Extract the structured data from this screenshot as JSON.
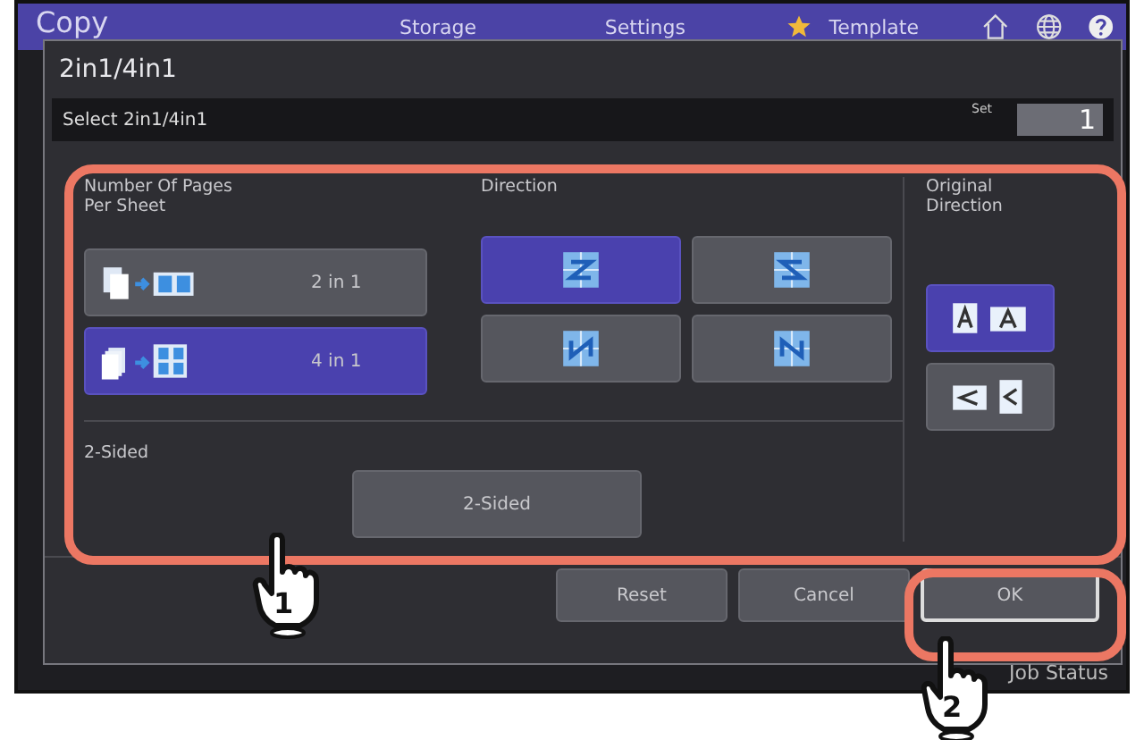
{
  "top_bar": {
    "title": "Copy",
    "tabs": [
      {
        "label": "Storage",
        "kind": "plain"
      },
      {
        "label": "Settings",
        "kind": "plain"
      },
      {
        "label": "Template",
        "kind": "star"
      }
    ]
  },
  "dialog": {
    "title": "2in1/4in1",
    "instruction": "Select 2in1/4in1",
    "set_label": "Set",
    "set_value": "1",
    "pages_per_sheet": {
      "label": "Number Of Pages Per Sheet",
      "options": [
        {
          "label": "2 in 1",
          "kind": "two",
          "selected": false
        },
        {
          "label": "4 in 1",
          "kind": "four",
          "selected": true
        }
      ]
    },
    "direction": {
      "label": "Direction",
      "options": [
        {
          "kind": "z",
          "selected": true
        },
        {
          "kind": "z-reverse",
          "selected": false
        },
        {
          "kind": "n-reverse",
          "selected": false
        },
        {
          "kind": "n",
          "selected": false
        }
      ]
    },
    "original_direction": {
      "label": "Original Direction",
      "options": [
        {
          "kind": "upright",
          "selected": true
        },
        {
          "kind": "sideways",
          "selected": false
        }
      ]
    },
    "two_sided": {
      "label": "2-Sided",
      "button": "2-Sided"
    },
    "buttons": [
      {
        "label": "Reset",
        "highlighted": false
      },
      {
        "label": "Cancel",
        "highlighted": false
      },
      {
        "label": "OK",
        "highlighted": true
      }
    ]
  },
  "status_bar": {
    "job_status": "Job Status"
  },
  "callouts": [
    {
      "label": "1"
    },
    {
      "label": "2"
    }
  ]
}
